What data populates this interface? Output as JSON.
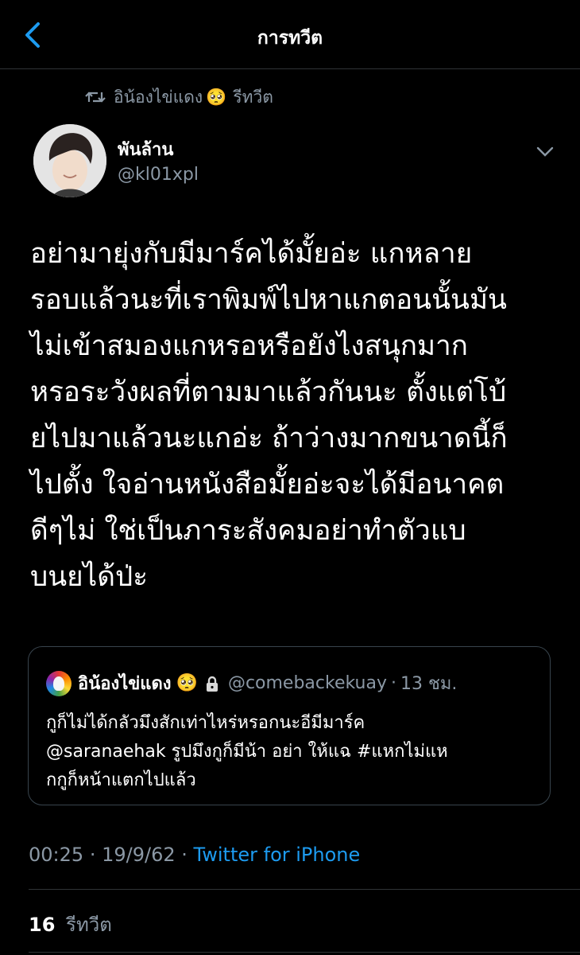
{
  "header": {
    "title": "การทวีต"
  },
  "retweet": {
    "name": "อิน้องไข่แดง",
    "emoji": "🥺",
    "label": "รีทวีต"
  },
  "author": {
    "name": "พันล้าน",
    "handle": "@kl01xpl"
  },
  "tweet": {
    "lines": [
      "อย่ามายุ่งกับมีมาร์คได้มั้ยอ่ะ แกหลาย",
      "รอบแล้วนะที่เราพิมพ์ไปหาแกตอนนั้นมัน",
      "ไม่เข้าสมองแกหรอหรือยังไงสนุกมาก",
      "หรอระวังผลที่ตามมาแล้วกันนะ ตั้งแต่โบ้",
      "ยไปมาแล้วนะแกอ่ะ ถ้าว่างมากขนาดนี้ก็",
      "ไปตั้ง ใจอ่านหนังสือมั้ยอ่ะจะได้มีอนาคต",
      "ดีๆไม่ ใช่เป็นภาระสังคมอย่าทำตัวแบ",
      "บนยได้ป่ะ"
    ]
  },
  "quote": {
    "name": "อิน้องไข่แดง",
    "emoji": "🥺",
    "handle": "@comebackekuay",
    "separator": "·",
    "time": "13 ชม.",
    "lines": [
      "กูก็ไม่ได้กลัวมึงสักเท่าไหร่หรอกนะอีมีมาร์ค",
      "@saranaehak รูปมึงกูก็มีน้า อย่า ให้แฉ #แหกไม่แห",
      "กกูก็หน้าแตกไปแล้ว"
    ]
  },
  "meta": {
    "time": "00:25",
    "separator": "·",
    "date": "19/9/62",
    "separator2": "·",
    "client": "Twitter for iPhone"
  },
  "stats": {
    "retweet_count": "16",
    "retweet_label": "รีทวีต"
  },
  "colors": {
    "background": "#000000",
    "text": "#ffffff",
    "secondary": "#8b98a5",
    "accent": "#1d9bf0",
    "border": "#2f3336"
  },
  "icons": {
    "back": "chevron-left-icon",
    "retweet": "retweet-icon",
    "caret": "chevron-down-icon",
    "lock": "lock-icon"
  }
}
